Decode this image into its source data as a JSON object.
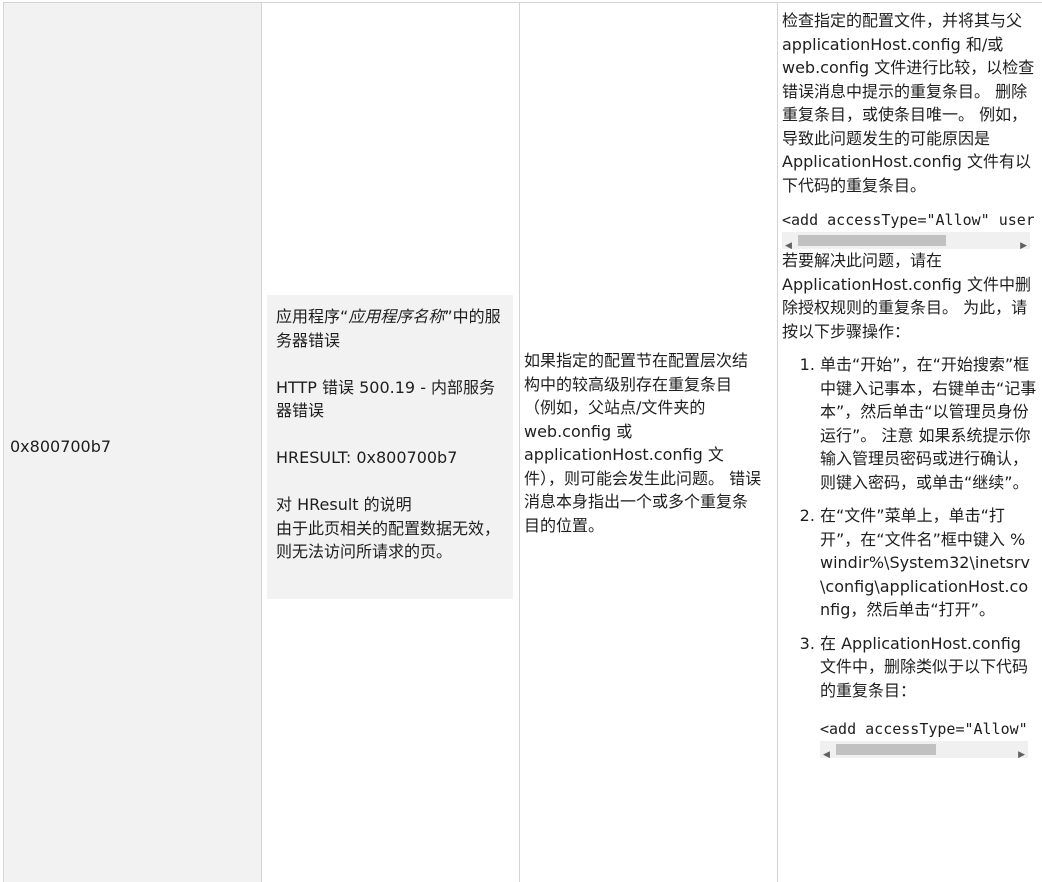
{
  "row": {
    "code": "0x800700b7",
    "message": {
      "line1_prefix": "应用程序“",
      "line1_italic": "应用程序名称",
      "line1_suffix": "”中的服务器错误",
      "http_error": "HTTP 错误 500.19 - 内部服务器错误",
      "hresult": "HRESULT: 0x800700b7",
      "desc_title": "对 HResult 的说明",
      "desc_text": "由于此页相关的配置数据无效，则无法访问所请求的页。"
    },
    "cause": "如果指定的配置节在配置层次结构中的较高级别存在重复条目（例如，父站点/文件夹的 web.config 或 applicationHost.config 文件），则可能会发生此问题。 错误消息本身指出一个或多个重复条目的位置。",
    "solution": {
      "intro": "检查指定的配置文件，并将其与父 applicationHost.config 和/或 web.config 文件进行比较，以检查错误消息中提示的重复条目。 删除重复条目，或使条目唯一。 例如，导致此问题发生的可能原因是 ApplicationHost.config 文件有以下代码的重复条目。",
      "code1": "<add accessType=\"Allow\" users=\"*\" />",
      "fix_intro": "若要解决此问题，请在 ApplicationHost.config 文件中删除授权规则的重复条目。 为此，请按以下步骤操作：",
      "steps": [
        "单击“开始”，在“开始搜索”框中键入记事本，右键单击“记事本”，然后单击“以管理员身份运行”。 注意 如果系统提示你输入管理员密码或进行确认，则键入密码，或单击“继续”。",
        "在“文件”菜单上，单击“打开”，在“文件名”框中键入 %windir%\\System32\\inetsrv\\config\\applicationHost.config，然后单击“打开”。",
        "在 ApplicationHost.config 文件中，删除类似于以下代码的重复条目："
      ],
      "code2": "<add accessType=\"Allow\" users=\"*\" />"
    }
  }
}
